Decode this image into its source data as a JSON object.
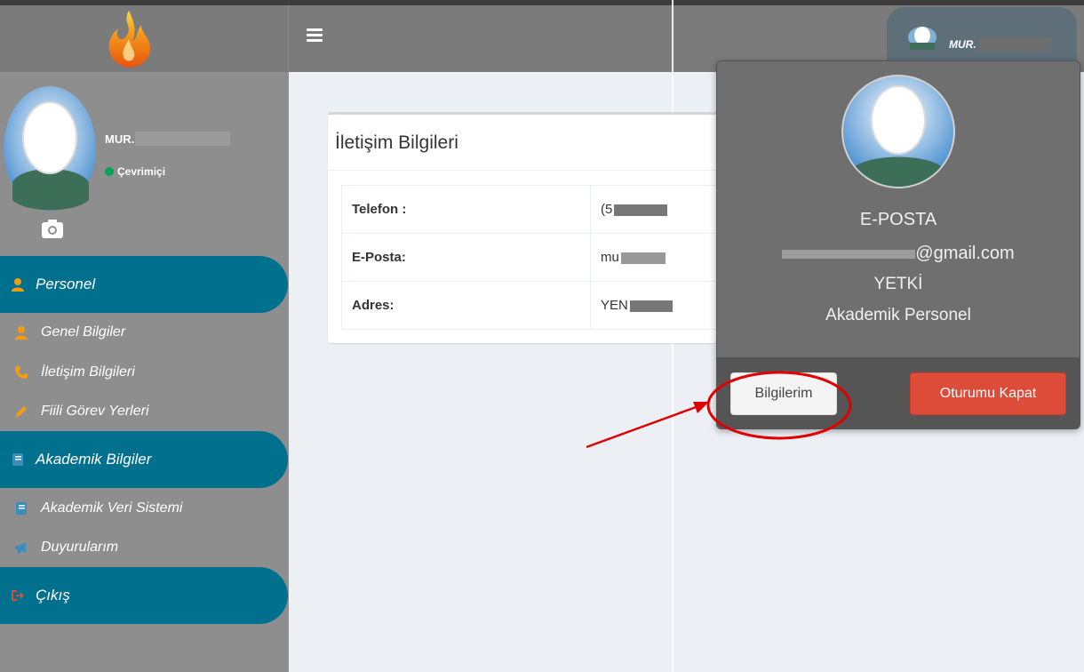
{
  "header": {
    "user_name": "MUR."
  },
  "sidebar": {
    "user_name": "MUR.",
    "status": "Çevrimiçi",
    "sections": [
      {
        "label": "Personel",
        "icon": "user-icon"
      },
      {
        "label": "Akademik Bilgiler",
        "icon": "book-icon"
      },
      {
        "label": "Çıkış",
        "icon": "sign-out-icon"
      }
    ],
    "items": [
      {
        "label": "Genel Bilgiler",
        "icon": "user-icon"
      },
      {
        "label": "İletişim Bilgileri",
        "icon": "phone-icon"
      },
      {
        "label": "Fiili Görev Yerleri",
        "icon": "pencil-icon"
      },
      {
        "label": "Akademik Veri Sistemi",
        "icon": "book-icon"
      },
      {
        "label": "Duyurularım",
        "icon": "bullhorn-icon"
      }
    ]
  },
  "contact": {
    "title": "İletişim Bilgileri",
    "rows": [
      {
        "label": "Telefon :",
        "value": "(5"
      },
      {
        "label": "E-Posta:",
        "value": "mu"
      },
      {
        "label": "Adres:",
        "value": "YEN"
      }
    ]
  },
  "dropdown": {
    "email_label": "E-POSTA",
    "email_value": "@gmail.com",
    "role_label": "YETKİ",
    "role_value": "Akademik Personel",
    "info_button": "Bilgilerim",
    "logout_button": "Oturumu Kapat"
  },
  "colors": {
    "nav_section": "#00708f",
    "logout": "#dd4b39",
    "annotation": "#e00000",
    "online": "#00a65a"
  }
}
